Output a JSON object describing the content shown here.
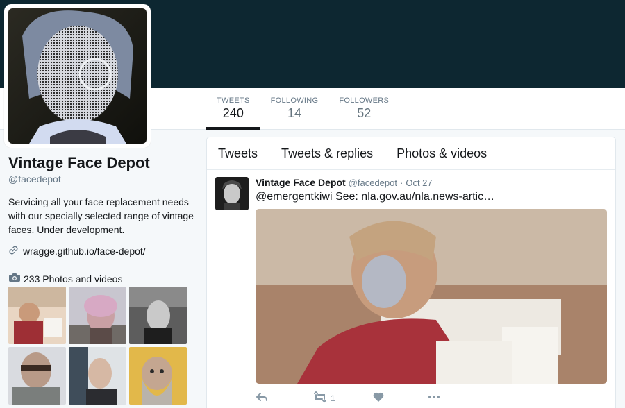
{
  "profile": {
    "name": "Vintage Face Depot",
    "handle": "@facedepot",
    "bio": "Servicing all your face replacement needs with our specially selected range of vintage faces. Under development.",
    "link": "wragge.github.io/face-depot/",
    "photos_label": "233 Photos and videos"
  },
  "stats": [
    {
      "label": "TWEETS",
      "value": "240"
    },
    {
      "label": "FOLLOWING",
      "value": "14"
    },
    {
      "label": "FOLLOWERS",
      "value": "52"
    }
  ],
  "tabs": [
    "Tweets",
    "Tweets & replies",
    "Photos & videos"
  ],
  "tweet": {
    "name": "Vintage Face Depot",
    "handle": "@facedepot",
    "separator": "·",
    "date": "Oct 27",
    "text": "@emergentkiwi See: nla.gov.au/nla.news-artic…",
    "retweets": "1"
  },
  "colors": {
    "banner": "#0d2731",
    "accent_underline": "#14171a",
    "muted": "#657786"
  },
  "icons": [
    "link-icon",
    "camera-icon",
    "reply-icon",
    "retweet-icon",
    "like-icon",
    "more-icon"
  ]
}
